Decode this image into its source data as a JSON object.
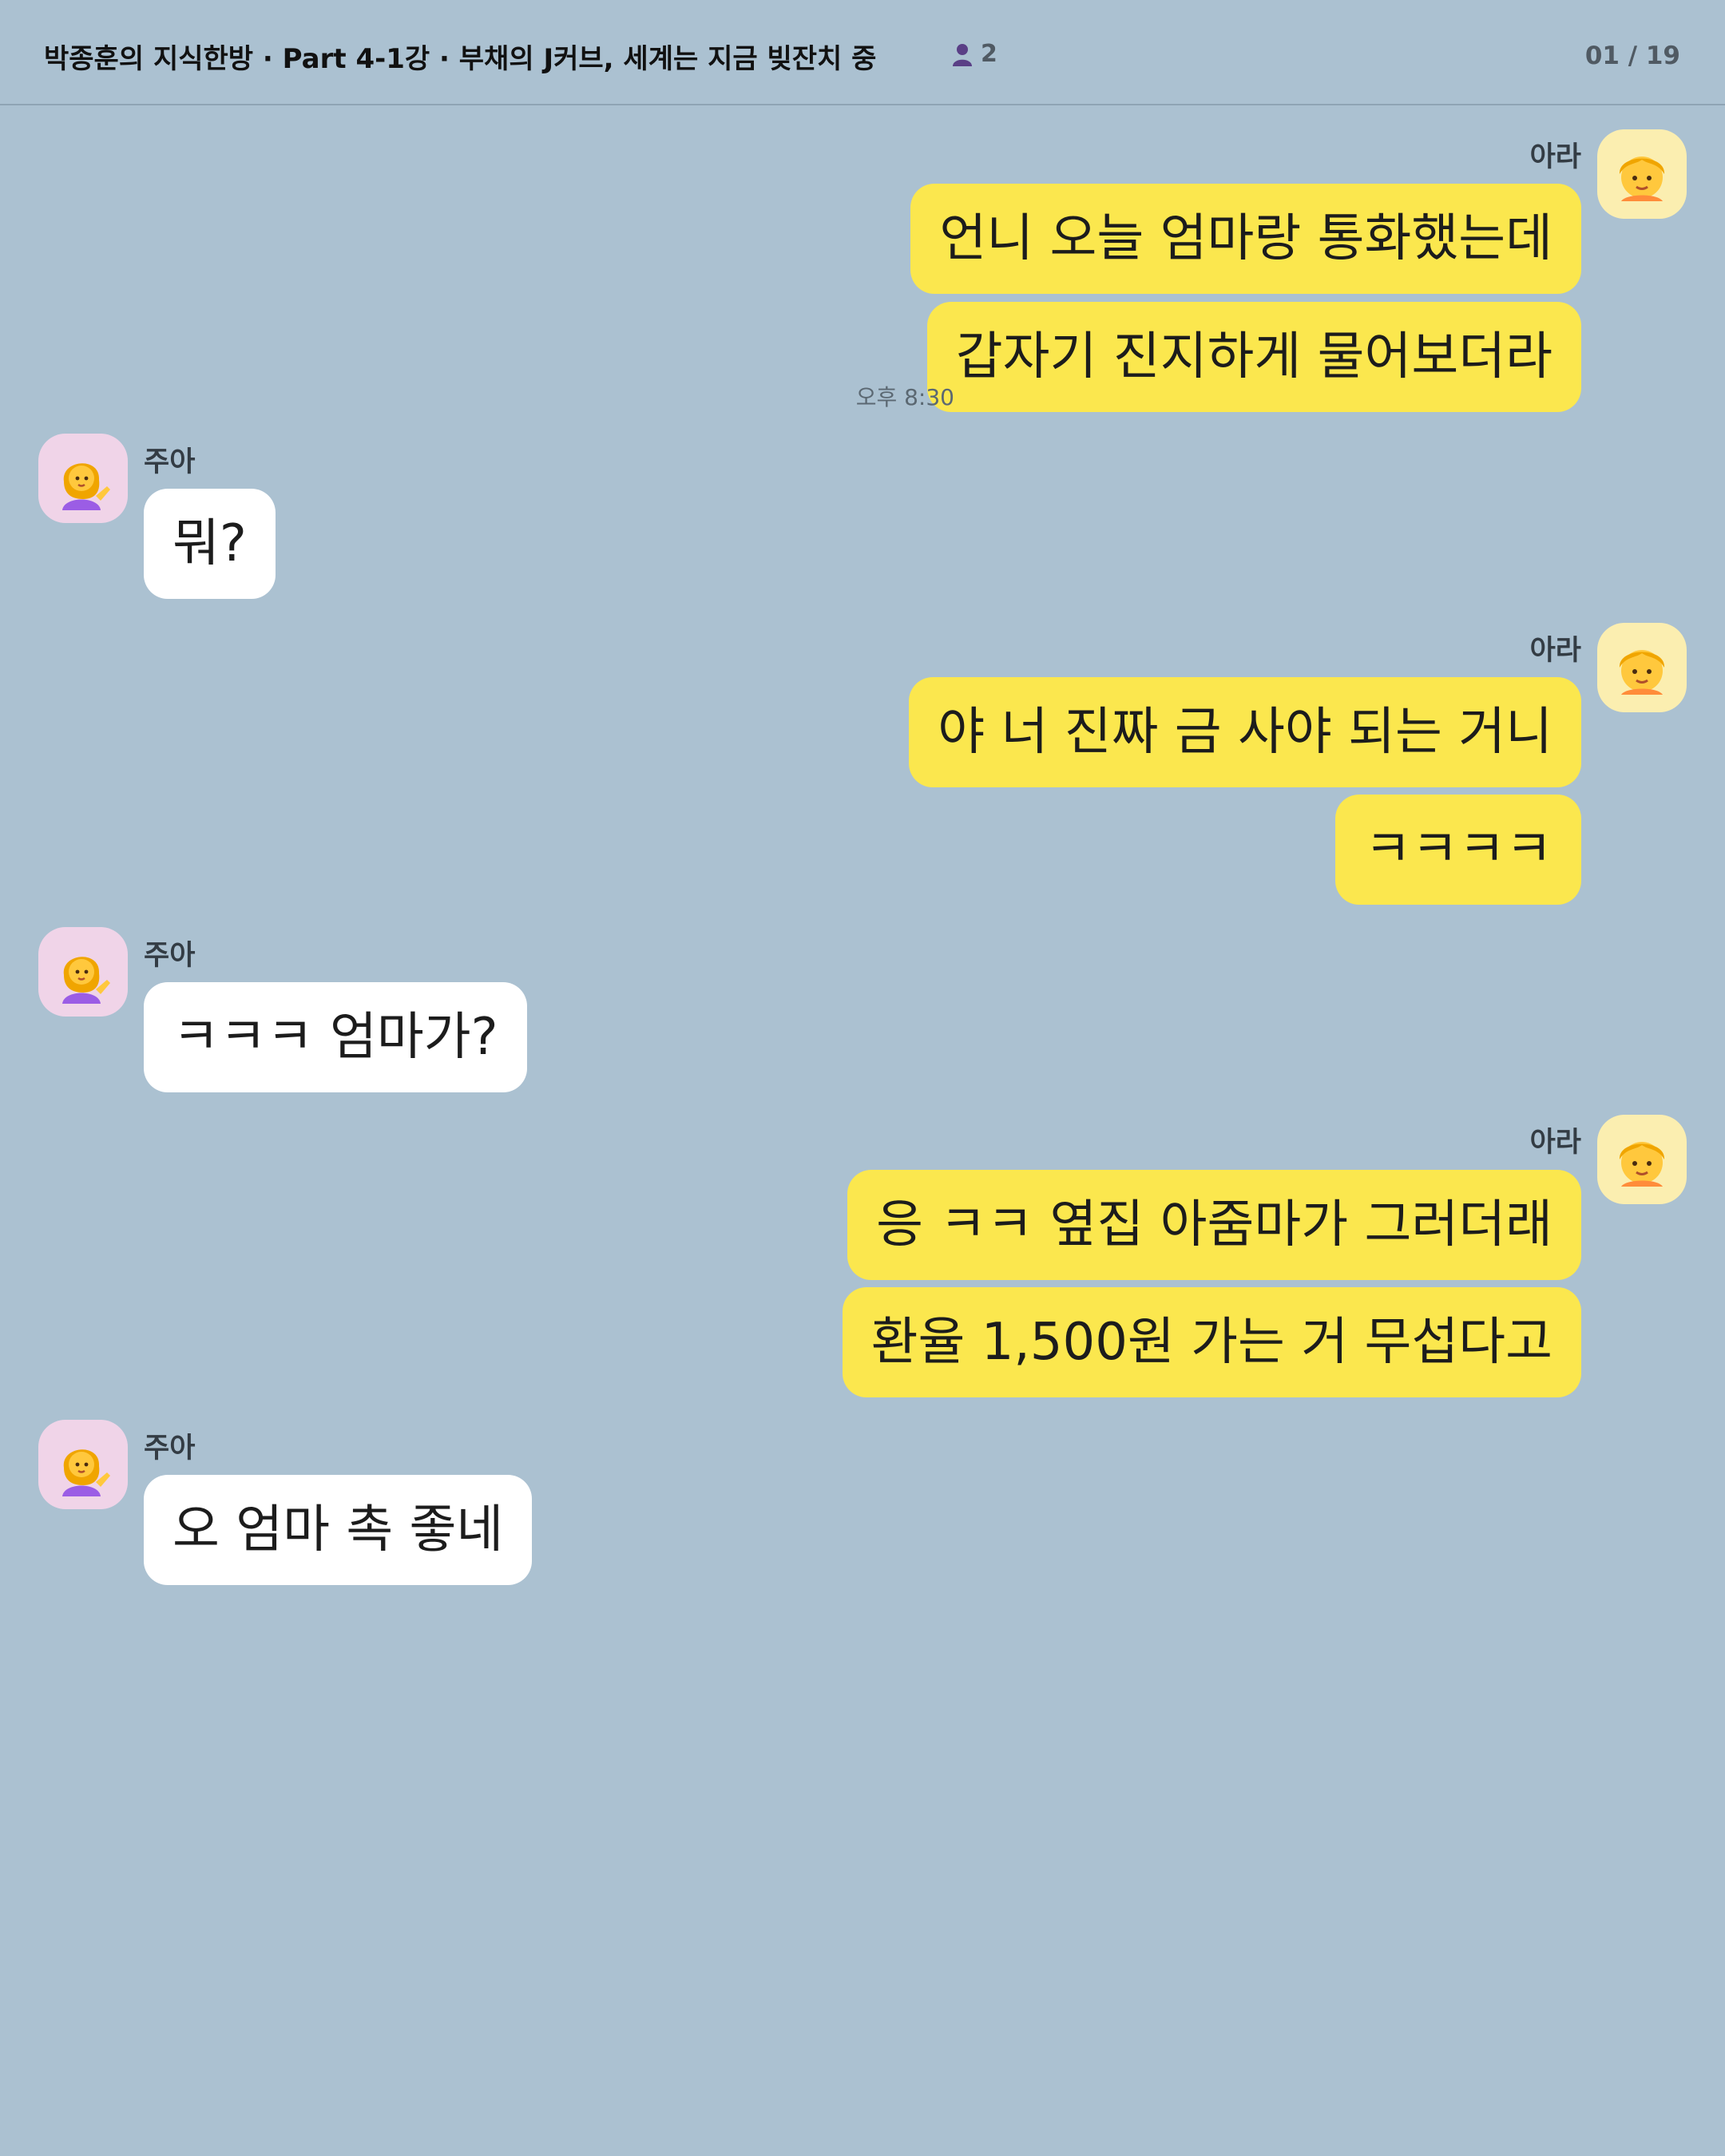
{
  "header": {
    "title": "박종훈의 지식한방 · Part 4-1강 · 부채의 J커브, 세계는 지금 빚잔치 중",
    "member_icon": "person-icon",
    "member_count": "2",
    "page_indicator": "01 / 19"
  },
  "participants": {
    "ara": {
      "name": "아라",
      "avatar": "girl-emoji-avatar"
    },
    "jua": {
      "name": "주아",
      "avatar": "woman-tipping-hand-emoji-avatar"
    }
  },
  "messages": [
    {
      "sender": "아라",
      "text": "언니 오늘 엄마랑 통화했는데"
    },
    {
      "sender": "아라",
      "text": "갑자기 진지하게 물어보더라",
      "time": "오후 8:30"
    },
    {
      "sender": "주아",
      "text": "뭐?"
    },
    {
      "sender": "아라",
      "text": "야 너 진짜 금 사야 되는 거니"
    },
    {
      "sender": "아라",
      "text": "ㅋㅋㅋㅋ"
    },
    {
      "sender": "주아",
      "text": "ㅋㅋㅋ 엄마가?"
    },
    {
      "sender": "아라",
      "text": "응 ㅋㅋ 옆집 아줌마가 그러더래"
    },
    {
      "sender": "아라",
      "text": "환율 1,500원 가는 거 무섭다고"
    },
    {
      "sender": "주아",
      "text": "오 엄마 촉 좋네"
    }
  ],
  "colors": {
    "background": "#abc1d1",
    "my_bubble": "#fbe74e",
    "their_bubble": "#ffffff"
  }
}
